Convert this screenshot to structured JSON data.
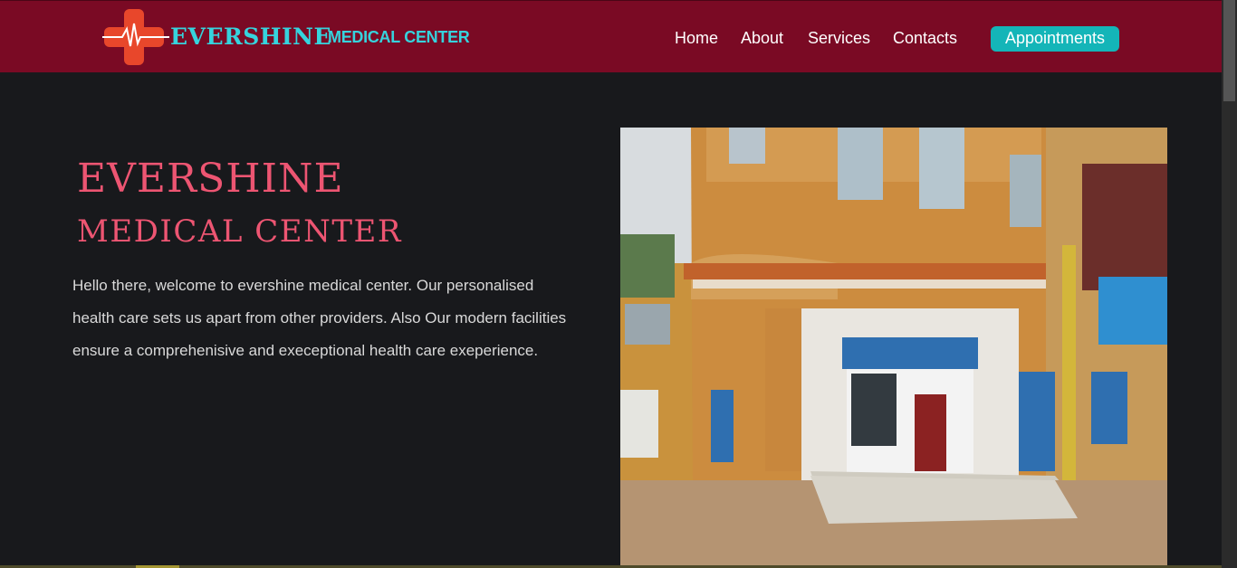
{
  "brand": {
    "name": "EVERSHINE",
    "subtitle": "MEDICAL CENTER",
    "logo_icon": "medical-cross-heartbeat-icon",
    "colors": {
      "header": "#7a0a24",
      "accent": "#36d3dd",
      "cross": "#e8472b",
      "button": "#14b5b8",
      "title": "#ed5572"
    }
  },
  "nav": {
    "home": "Home",
    "about": "About",
    "services": "Services",
    "contacts": "Contacts",
    "appointments": "Appointments"
  },
  "hero": {
    "title": "EVERSHINE",
    "subtitle": "MEDICAL CENTER",
    "text": "Hello there, welcome to evershine medical center. Our personalised health care sets us apart from other providers. Also Our modern facilities ensure a comprehenisive and execeptional health care exeperience.",
    "image_description": "photo of medical center building"
  }
}
